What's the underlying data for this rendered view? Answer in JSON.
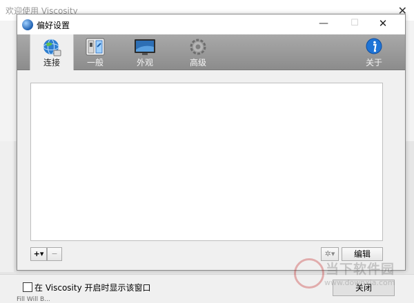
{
  "background_window": {
    "title": "欢迎使用 Viscosity",
    "close_glyph": "✕",
    "show_on_launch_label": "在 Viscosity 开启时显示该窗口",
    "close_button_label": "关闭",
    "cut_text": "Fill Will B..."
  },
  "dialog": {
    "title": "偏好设置",
    "minimize_glyph": "—",
    "maximize_glyph": "☐",
    "close_glyph": "✕",
    "tabs": [
      {
        "label": "连接",
        "icon": "globe-connection-icon",
        "active": true
      },
      {
        "label": "一般",
        "icon": "switch-panel-icon",
        "active": false
      },
      {
        "label": "外观",
        "icon": "monitor-icon",
        "active": false
      },
      {
        "label": "高级",
        "icon": "gear-icon",
        "active": false
      },
      {
        "label": "关于",
        "icon": "info-icon",
        "active": false
      }
    ],
    "add_label": "+▾",
    "remove_label": "−",
    "gear_label": "✲▾",
    "edit_label": "编辑"
  },
  "watermark": {
    "text": "当下软件园",
    "url": "www.downxia.com"
  }
}
